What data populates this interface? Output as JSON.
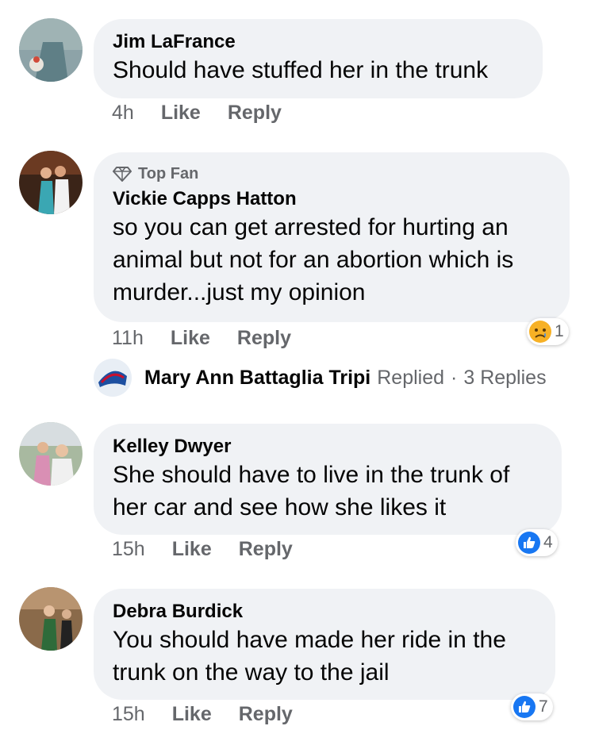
{
  "comments": [
    {
      "name": "Jim LaFrance",
      "lines": [
        "Should have stuffed her in the trunk"
      ],
      "time": "4h",
      "like": "Like",
      "reply": "Reply"
    },
    {
      "badge": "Top Fan",
      "name": "Vickie Capps Hatton",
      "lines": [
        "so you can get arrested for hurting an",
        "animal but not for an abortion which is",
        "murder...just my opinion"
      ],
      "time": "11h",
      "like": "Like",
      "reply": "Reply",
      "reaction": {
        "icon": "sad-emoji-icon",
        "count": "1"
      }
    },
    {
      "name": "Kelley Dwyer",
      "lines": [
        "She should have to live in the trunk of",
        "her car and see how she likes it"
      ],
      "time": "15h",
      "like": "Like",
      "reply": "Reply",
      "reaction": {
        "icon": "thumbs-up-icon",
        "count": "4"
      }
    },
    {
      "name": "Debra Burdick",
      "lines": [
        "You should have made her ride in the",
        "trunk on the way to the jail"
      ],
      "time": "15h",
      "like": "Like",
      "reply": "Reply",
      "reaction": {
        "icon": "thumbs-up-icon",
        "count": "7"
      }
    }
  ],
  "replies_summary": {
    "name": "Mary Ann Battaglia Tripi",
    "action": "Replied",
    "separator": "·",
    "count_text": "3 Replies"
  },
  "colors": {
    "bubble": "#f0f2f5",
    "secondary_text": "#65676b",
    "like_blue": "#1877f2",
    "sad_yellow": "#f7b125"
  }
}
